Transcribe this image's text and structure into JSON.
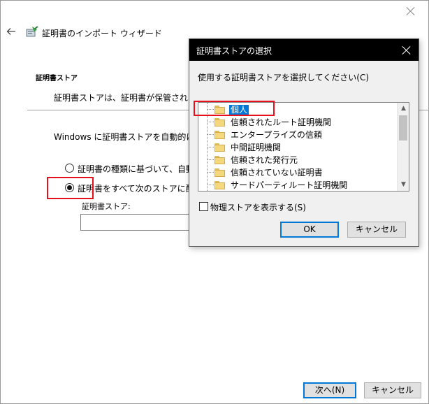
{
  "wizard": {
    "title": "証明書のインポート ウィザード",
    "back_icon": "back-arrow-icon",
    "app_icon": "certificate-wizard-icon",
    "section_heading": "証明書ストア",
    "section_description": "証明書ストアは、証明書が保管されるシス",
    "auto_select_text": "Windows に証明書ストアを自動的に選択",
    "radio_auto_label": "証明書の種類に基づいて、自動的",
    "radio_manual_label": "証明書をすべて次のストアに配置す",
    "store_label": "証明書ストア:",
    "store_value": "",
    "next_button": "次へ(N)",
    "cancel_button": "キャンセル"
  },
  "dialog": {
    "title": "証明書ストアの選択",
    "prompt": "使用する証明書ストアを選択してください(C)",
    "stores": [
      "個人",
      "信頼されたルート証明機関",
      "エンタープライズの信頼",
      "中間証明機関",
      "信頼された発行元",
      "信頼されていない証明書",
      "サードパーティルート証明機関"
    ],
    "selected_index": 0,
    "show_physical_label": "物理ストアを表示する(S)",
    "show_physical_checked": false,
    "ok_button": "OK",
    "cancel_button": "キャンセル"
  },
  "colors": {
    "highlight_box": "#e8101c",
    "selection": "#0078d7",
    "dialog_titlebar": "#000000"
  }
}
